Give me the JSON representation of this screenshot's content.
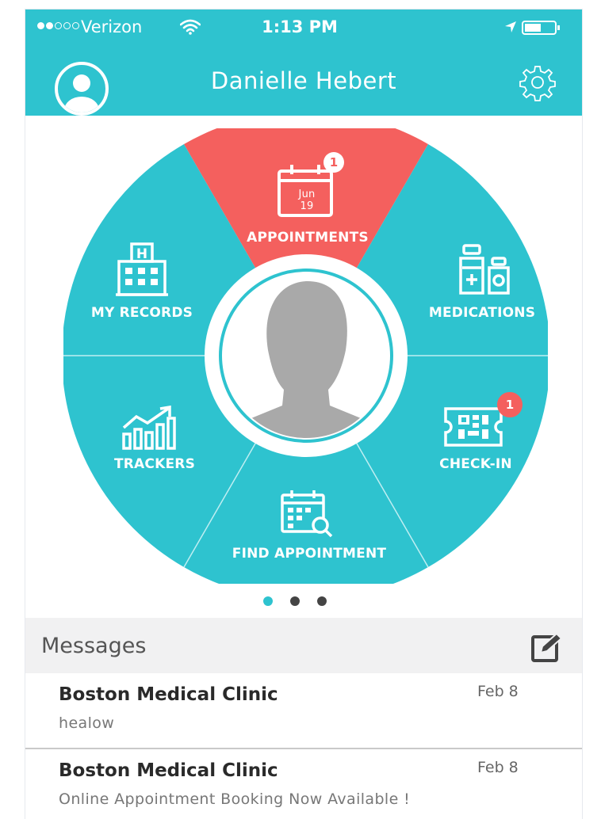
{
  "status_bar": {
    "carrier": "Verizon",
    "time": "1:13 PM",
    "signal_bars_filled": 2,
    "signal_bars_total": 5
  },
  "header": {
    "user_name": "Danielle Hebert",
    "avatar_icon": "user-avatar-icon",
    "settings_icon": "gear-icon"
  },
  "wheel": {
    "center_icon": "profile-silhouette-icon",
    "segments": [
      {
        "key": "appointments",
        "label": "APPOINTMENTS",
        "icon": "calendar-icon",
        "calendar_month": "Jun",
        "calendar_day": "19",
        "badge": "1",
        "color": "#f4605e"
      },
      {
        "key": "medications",
        "label": "MEDICATIONS",
        "icon": "medicine-bottles-icon",
        "color": "#2ec3cf"
      },
      {
        "key": "check_in",
        "label": "CHECK-IN",
        "icon": "qr-ticket-icon",
        "badge": "1",
        "color": "#2ec3cf"
      },
      {
        "key": "find_appointment",
        "label": "FIND APPOINTMENT",
        "icon": "calendar-search-icon",
        "color": "#2ec3cf"
      },
      {
        "key": "trackers",
        "label": "TRACKERS",
        "icon": "trend-chart-icon",
        "color": "#2ec3cf"
      },
      {
        "key": "my_records",
        "label": "MY RECORDS",
        "icon": "hospital-building-icon",
        "color": "#2ec3cf"
      }
    ]
  },
  "pager": {
    "pages": 3,
    "current": 1
  },
  "messages": {
    "title": "Messages",
    "compose_icon": "compose-icon",
    "items": [
      {
        "sender": "Boston Medical Clinic",
        "date": "Feb 8",
        "preview": "healow"
      },
      {
        "sender": "Boston Medical Clinic",
        "date": "Feb 8",
        "preview": "Online Appointment Booking Now Available !"
      }
    ]
  },
  "colors": {
    "primary": "#2ec3cf",
    "accent": "#f4605e",
    "badge": "#f4605e",
    "messages_header_bg": "#f1f1f2"
  }
}
